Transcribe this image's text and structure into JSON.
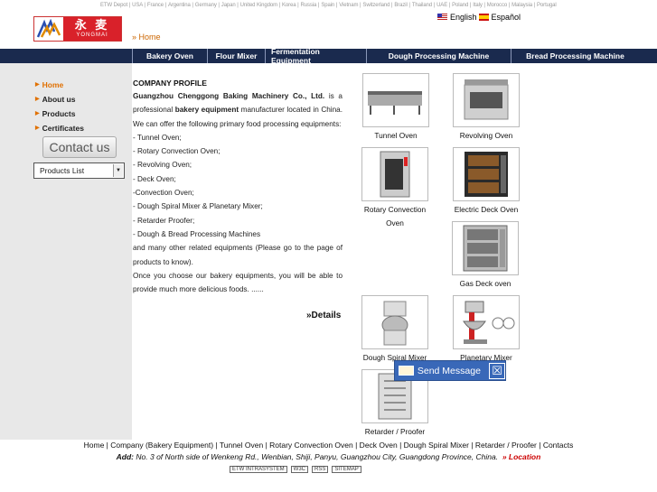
{
  "header": {
    "top_links": [
      "ETW Depot",
      "USA",
      "France",
      "Argentina",
      "Germany",
      "Japan",
      "United Kingdom",
      "Korea",
      "Russia",
      "Spain",
      "Vietnam",
      "Switzerland",
      "Brazil",
      "Thailand",
      "UAE",
      "Poland",
      "Italy",
      "Morocco",
      "Malaysia",
      "Portugal"
    ],
    "logo_cn": "永 麦",
    "logo_en": "YONGMAI",
    "lang_en": "English",
    "lang_es": "Español",
    "breadcrumb": "» Home"
  },
  "nav": [
    "Bakery Oven",
    "Flour Mixer",
    "Fermentation Equipment",
    "Dough Processing Machine",
    "Bread Processing Machine"
  ],
  "sidebar": {
    "items": [
      {
        "label": "Home"
      },
      {
        "label": "About us"
      },
      {
        "label": "Products"
      },
      {
        "label": "Certificates"
      }
    ],
    "contact_label": "Contact us",
    "products_list": "Products List"
  },
  "profile": {
    "title": "COMPANY PROFILE",
    "company": "Guangzhou Chenggong Baking Machinery Co., Ltd.",
    "intro1": "is a professional",
    "bakery_equipment": "bakery equipment",
    "intro2": "manufacturer located in China. We can offer the following primary food processing equipments:",
    "list": [
      "- Tunnel Oven;",
      "- Rotary Convection Oven;",
      "- Revolving Oven;",
      "- Deck Oven;",
      "-Convection Oven;",
      "- Dough Spiral Mixer & Planetary Mixer;",
      "- Retarder Proofer;",
      "- Dough & Bread Processing Machines"
    ],
    "outro1": "and many other related equipments (Please go to the page of products to know).",
    "outro2": "Once you choose our bakery equipments, you will be able to provide much more delicious foods. ......",
    "details": "»Details"
  },
  "products": [
    {
      "name": "Tunnel Oven"
    },
    {
      "name": "Revolving Oven"
    },
    {
      "name": "Rotary Convection Oven"
    },
    {
      "name": "Electric Deck Oven"
    },
    {
      "name": "Gas Deck oven"
    },
    {
      "name": "Dough Spiral Mixer"
    },
    {
      "name": "Planetary Mixer"
    },
    {
      "name": "Retarder / Proofer"
    }
  ],
  "send_message": "Send Message",
  "footer": {
    "links": "Home | Company (Bakery Equipment) | Tunnel Oven | Rotary Convection Oven | Deck Oven | Dough Spiral Mixer | Retarder / Proofer | Contacts",
    "add_label": "Add:",
    "address": "No. 3 of North side of Wenkeng Rd., Wenbian, Shiji, Panyu, Guangzhou City, Guangdong Province, China.",
    "location": "» Location",
    "badges": [
      "ETW INTRASYSTEM",
      "W3C",
      "RSS",
      "SITEMAP"
    ]
  },
  "colors": {
    "nav_bg": "#1a2a4e",
    "accent": "#e07000",
    "logo_red": "#d9212a",
    "send_bg": "#3968b8"
  }
}
